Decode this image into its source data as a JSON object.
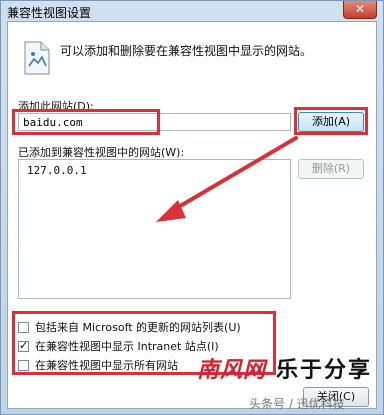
{
  "window": {
    "title": "兼容性视图设置",
    "close_glyph": "✕"
  },
  "intro_text": "可以添加和删除要在兼容性视图中显示的网站。",
  "add_site": {
    "label": "添加此网站(D):",
    "value": "baidu.com",
    "add_button": "添加(A)"
  },
  "site_list": {
    "label": "已添加到兼容性视图中的网站(W):",
    "items": [
      "127.0.0.1"
    ],
    "delete_button": "删除(R)"
  },
  "options": [
    {
      "label": "包括来自 Microsoft 的更新的网站列表(U)",
      "checked": false
    },
    {
      "label": "在兼容性视图中显示 Intranet 站点(I)",
      "checked": true
    },
    {
      "label": "在兼容性视图中显示所有网站",
      "checked": false
    }
  ],
  "close_button": "关闭(C)",
  "watermark": {
    "brand_red": "南风网",
    "brand_black": "乐于分享",
    "author": "头条号 / 迅优科技"
  },
  "colors": {
    "highlight": "#d9303a",
    "accent": "#3a86c8"
  },
  "icons": {
    "page": "document-icon",
    "close": "close-icon"
  }
}
